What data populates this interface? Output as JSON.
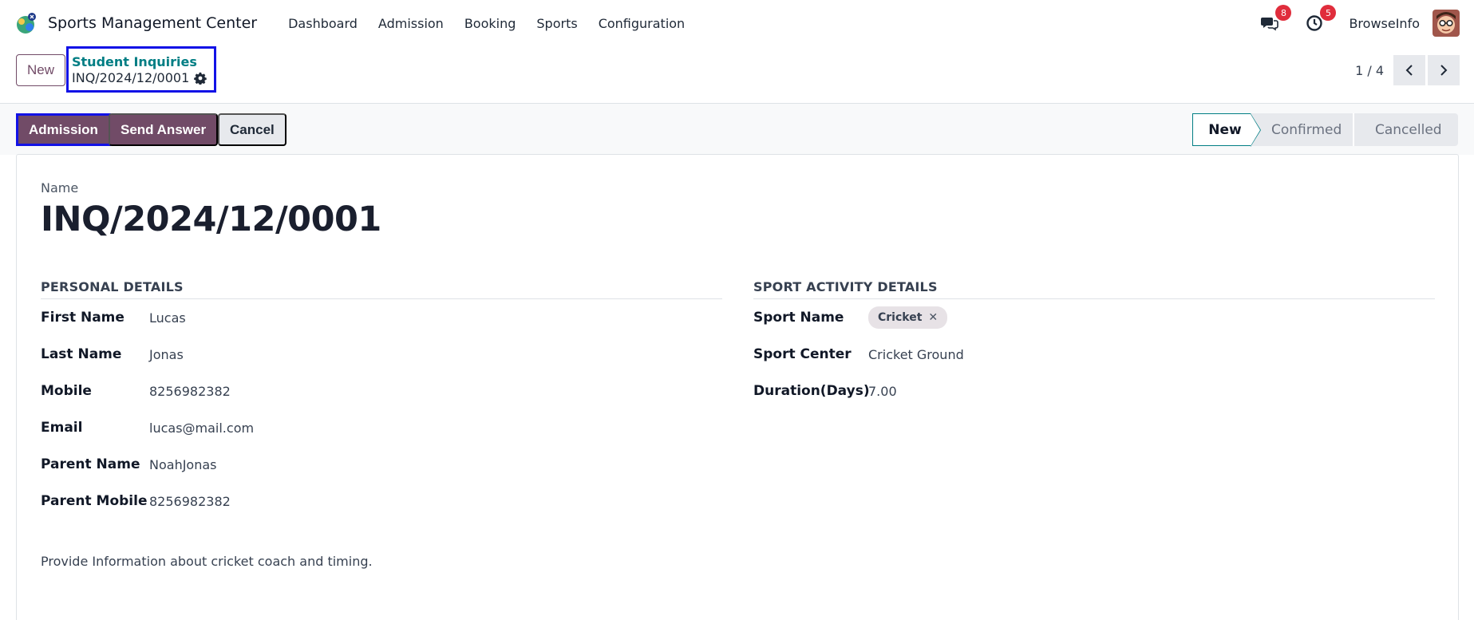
{
  "app": {
    "title": "Sports Management Center",
    "brand_color": "#714b67",
    "accent_color": "#017e84"
  },
  "nav": {
    "items": [
      "Dashboard",
      "Admission",
      "Booking",
      "Sports",
      "Configuration"
    ]
  },
  "systray": {
    "messages_count": "8",
    "activities_count": "5",
    "user_name": "BrowseInfo"
  },
  "control_panel": {
    "new_label": "New",
    "breadcrumb_parent": "Student Inquiries",
    "breadcrumb_current": "INQ/2024/12/0001",
    "pager_value": "1 / 4"
  },
  "actions": {
    "admission": "Admission",
    "send_answer": "Send Answer",
    "cancel": "Cancel"
  },
  "status": {
    "steps": [
      "New",
      "Confirmed",
      "Cancelled"
    ],
    "active": "New"
  },
  "form": {
    "name_label": "Name",
    "name_value": "INQ/2024/12/0001",
    "personal": {
      "title": "PERSONAL DETAILS",
      "fields": [
        {
          "label": "First Name",
          "value": "Lucas"
        },
        {
          "label": "Last Name",
          "value": "Jonas"
        },
        {
          "label": "Mobile",
          "value": "8256982382"
        },
        {
          "label": "Email",
          "value": "lucas@mail.com"
        },
        {
          "label": "Parent Name",
          "value": "NoahJonas"
        },
        {
          "label": "Parent Mobile",
          "value": "8256982382"
        }
      ]
    },
    "sport": {
      "title": "SPORT ACTIVITY DETAILS",
      "sport_name_label": "Sport Name",
      "sport_name_tag": "Cricket",
      "sport_center_label": "Sport Center",
      "sport_center_value": "Cricket Ground",
      "duration_label": "Duration(Days)",
      "duration_value": "7.00"
    },
    "notes": "Provide Information about cricket coach and timing."
  }
}
